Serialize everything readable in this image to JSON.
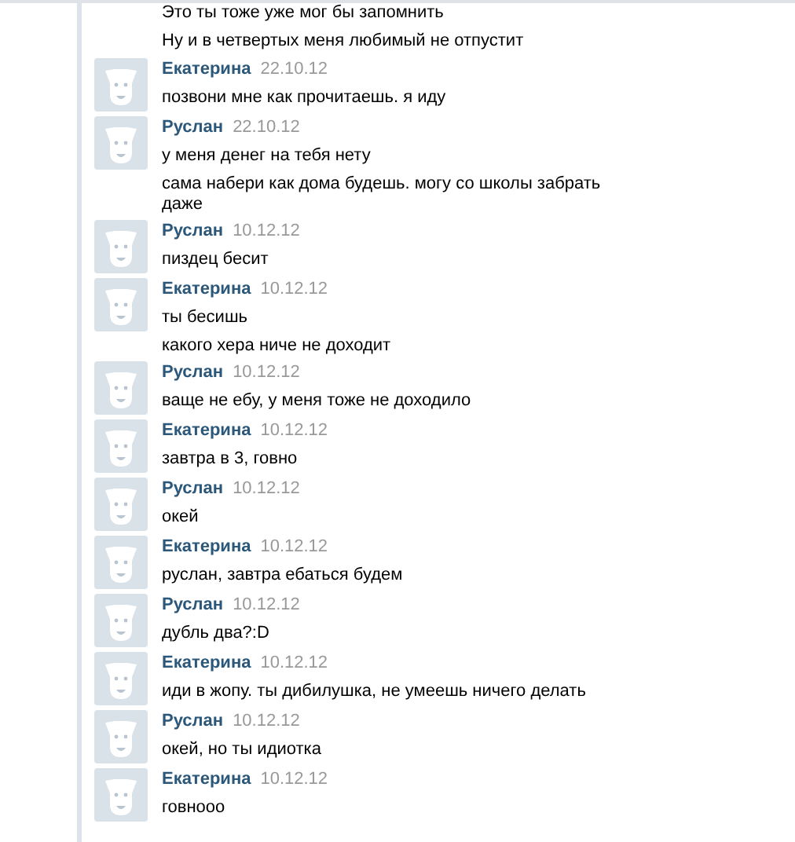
{
  "messages": [
    {
      "kind": "continuation",
      "lines": [
        "Это ты тоже уже мог бы запомнить",
        "Ну и в четвертых меня любимый не отпустит"
      ]
    },
    {
      "kind": "post",
      "author": "Екатерина",
      "date": "22.10.12",
      "lines": [
        "позвони мне как прочитаешь. я иду"
      ]
    },
    {
      "kind": "post",
      "author": "Руслан",
      "date": "22.10.12",
      "lines": [
        "у меня денег на тебя нету",
        "сама набери как дома будешь. могу со школы забрать даже"
      ]
    },
    {
      "kind": "post",
      "author": "Руслан",
      "date": "10.12.12",
      "lines": [
        "пиздец бесит"
      ]
    },
    {
      "kind": "post",
      "author": "Екатерина",
      "date": "10.12.12",
      "lines": [
        "ты бесишь",
        "какого хера ниче не доходит"
      ]
    },
    {
      "kind": "post",
      "author": "Руслан",
      "date": "10.12.12",
      "lines": [
        "ваще не ебу, у меня тоже не доходило"
      ]
    },
    {
      "kind": "post",
      "author": "Екатерина",
      "date": "10.12.12",
      "lines": [
        "завтра в 3, говно"
      ]
    },
    {
      "kind": "post",
      "author": "Руслан",
      "date": "10.12.12",
      "lines": [
        "окей"
      ]
    },
    {
      "kind": "post",
      "author": "Екатерина",
      "date": "10.12.12",
      "lines": [
        "руслан, завтра ебаться будем"
      ]
    },
    {
      "kind": "post",
      "author": "Руслан",
      "date": "10.12.12",
      "lines": [
        "дубль два?:D"
      ]
    },
    {
      "kind": "post",
      "author": "Екатерина",
      "date": "10.12.12",
      "lines": [
        "иди в жопу. ты дибилушка, не умеешь ничего делать"
      ]
    },
    {
      "kind": "post",
      "author": "Руслан",
      "date": "10.12.12",
      "lines": [
        "окей, но ты идиотка"
      ]
    },
    {
      "kind": "post",
      "author": "Екатерина",
      "date": "10.12.12",
      "lines": [
        "говнооо"
      ]
    }
  ]
}
